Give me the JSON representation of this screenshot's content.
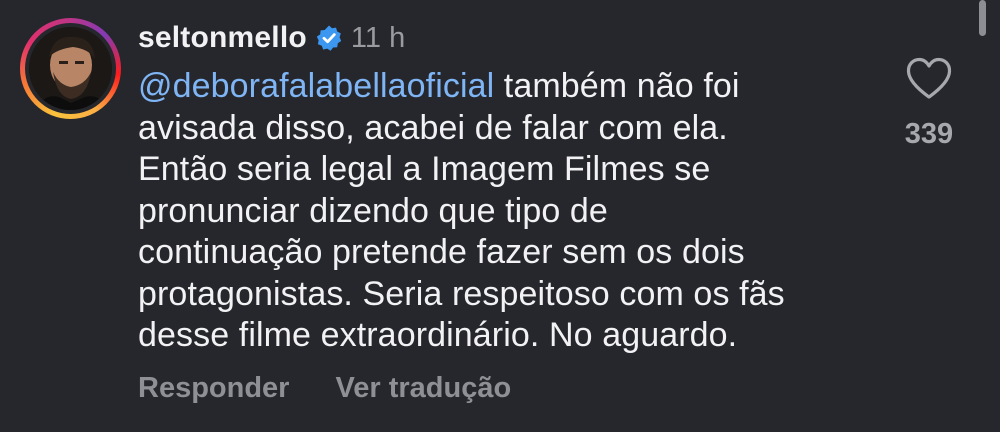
{
  "comment": {
    "username": "seltonmello",
    "timestamp": "11 h",
    "verified": true,
    "avatar_icon": "profile-photo",
    "mention": "@deborafalabellaoficial",
    "lines": [
      " também não foi",
      "avisada disso, acabei de falar com ela.",
      "Então seria legal a Imagem Filmes se",
      "pronunciar dizendo que tipo de",
      "continuação pretende fazer sem os dois",
      "protagonistas. Seria respeitoso com os fãs",
      "desse filme extraordinário. No aguardo."
    ],
    "likes": "339"
  },
  "actions": {
    "reply_label": "Responder",
    "translate_label": "Ver tradução"
  },
  "colors": {
    "background": "#25272c",
    "text": "#f2f2f4",
    "mention": "#7fb5f5",
    "muted": "#8f9096",
    "verified": "#3b97f0"
  }
}
